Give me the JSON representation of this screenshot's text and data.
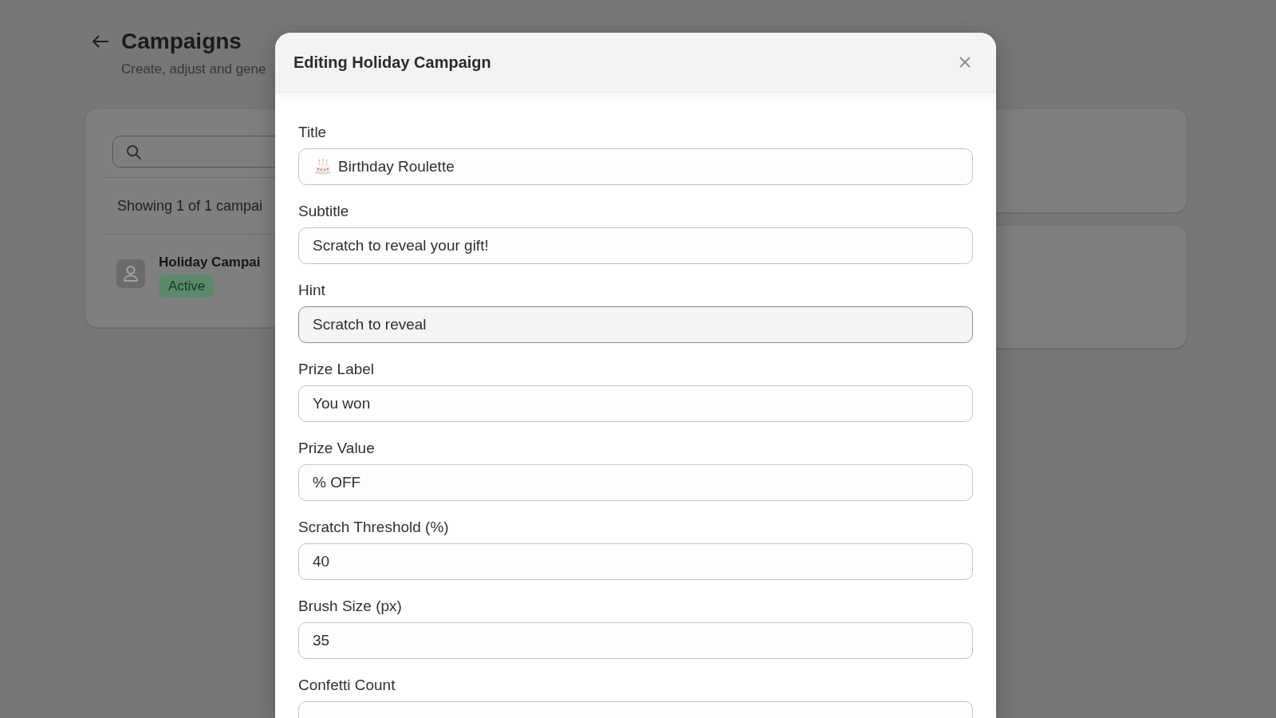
{
  "page": {
    "title": "Campaigns",
    "subtitle": "Create, adjust and gene"
  },
  "campaign_list": {
    "summary": "Showing 1 of 1 campai",
    "campaigns": [
      {
        "name": "Holiday Campai",
        "status": "Active"
      }
    ]
  },
  "dialog": {
    "title": "Editing Holiday Campaign",
    "fields": [
      {
        "label": "Title",
        "kind": "emoji",
        "value": "Birthday Roulette",
        "hovered": false
      },
      {
        "label": "Subtitle",
        "kind": "text",
        "value": "Scratch to reveal your gift!",
        "hovered": false
      },
      {
        "label": "Hint",
        "kind": "text",
        "value": "Scratch to reveal",
        "hovered": true
      },
      {
        "label": "Prize Label",
        "kind": "text",
        "value": "You won",
        "hovered": false
      },
      {
        "label": "Prize Value",
        "kind": "text",
        "value": "% OFF",
        "hovered": false
      },
      {
        "label": "Scratch Threshold (%)",
        "kind": "text",
        "value": "40",
        "hovered": false
      },
      {
        "label": "Brush Size (px)",
        "kind": "text",
        "value": "35",
        "hovered": false
      },
      {
        "label": "Confetti Count",
        "kind": "text",
        "hovered": false
      }
    ]
  }
}
